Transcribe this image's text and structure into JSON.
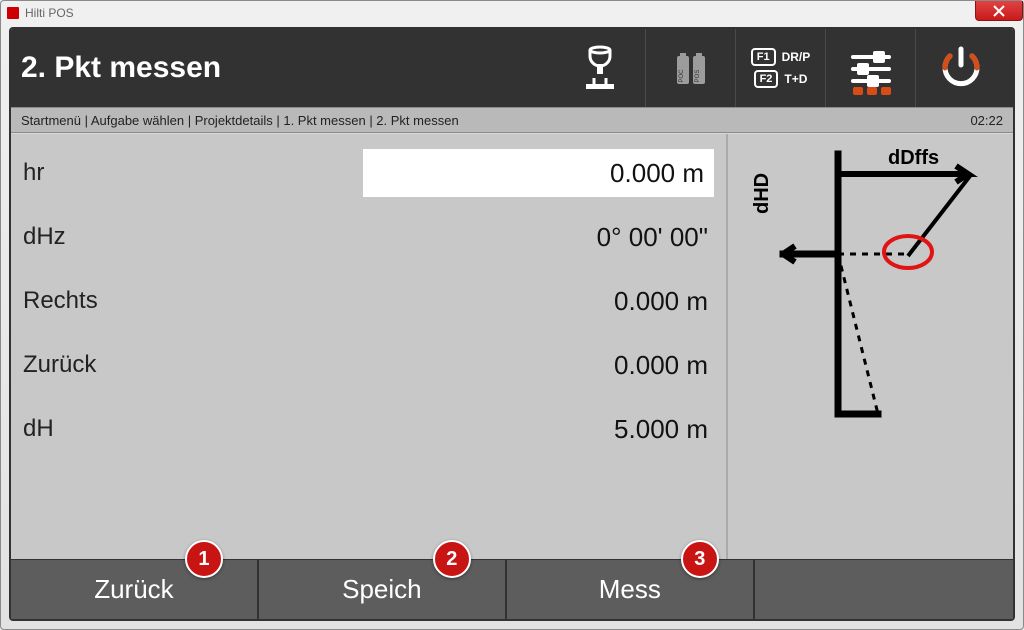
{
  "window": {
    "app_title": "Hilti POS"
  },
  "header": {
    "title": "2. Pkt messen",
    "fkeys": {
      "f1_key": "F1",
      "f1_label": "DR/P",
      "f2_key": "F2",
      "f2_label": "T+D"
    }
  },
  "breadcrumb": {
    "items": [
      "Startmenü",
      "Aufgabe wählen",
      "Projektdetails",
      "1. Pkt messen",
      "2. Pkt messen"
    ],
    "joined": "Startmenü | Aufgabe wählen | Projektdetails | 1. Pkt messen | 2. Pkt messen",
    "clock": "02:22"
  },
  "readings": {
    "hr": {
      "label": "hr",
      "value": "0.000 m"
    },
    "dHz": {
      "label": "dHz",
      "value": "0° 00' 00\""
    },
    "rechts": {
      "label": "Rechts",
      "value": "0.000 m"
    },
    "zurueck": {
      "label": "Zurück",
      "value": "0.000 m"
    },
    "dH": {
      "label": "dH",
      "value": "5.000 m"
    }
  },
  "diagram": {
    "axis_v": "dHD",
    "axis_h": "dDffs"
  },
  "actions": {
    "back": {
      "label": "Zurück",
      "badge": "1"
    },
    "save": {
      "label": "Speich",
      "badge": "2"
    },
    "measure": {
      "label": "Mess",
      "badge": "3"
    }
  }
}
